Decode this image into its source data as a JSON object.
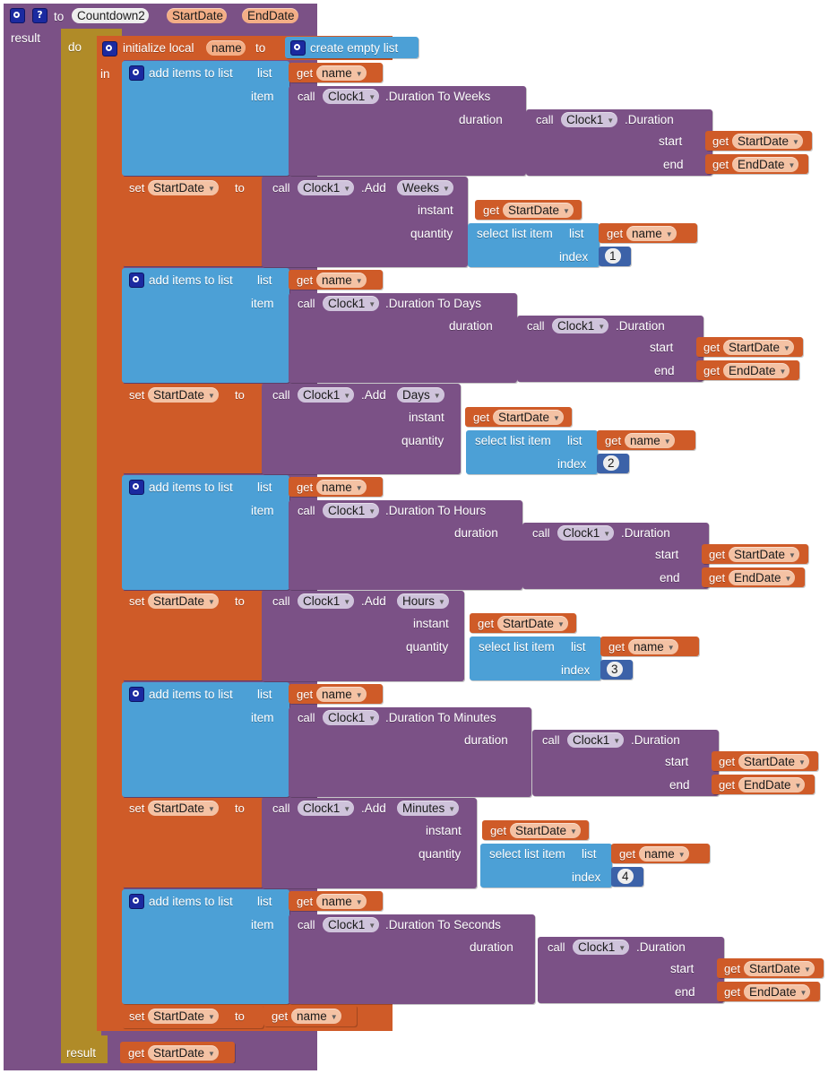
{
  "editor": {
    "name": "MIT App Inventor Blocks Editor",
    "colors": {
      "procedure": "#7B5186",
      "control_gold": "#B08B28",
      "variable_orange": "#CF5B28",
      "list_blue": "#4CA0D6",
      "math_blue": "#3C62A8",
      "field_lavender": "#CFC3DB",
      "field_salmon": "#F3AE86"
    }
  },
  "icons": {
    "gear": "gear-icon",
    "help": "help-icon",
    "dropdown_arrow": "▼"
  },
  "procedure": {
    "to_label": "to",
    "name": "Countdown2",
    "params": [
      "StartDate",
      "EndDate"
    ],
    "result_label": "result",
    "do_label": "do",
    "in_label": "in"
  },
  "local_init": {
    "label": "initialize local",
    "var_name": "name",
    "to_label": "to",
    "value_block": "create empty list"
  },
  "labels": {
    "add_items_to_list": "add items to list",
    "list": "list",
    "item": "item",
    "get": "get",
    "call": "call",
    "set": "set",
    "to": "to",
    "duration": "duration",
    "start": "start",
    "end": "end",
    "instant": "instant",
    "quantity": "quantity",
    "select_list_item": "select list item",
    "index": "index",
    "clock_component": "Clock1",
    "duration_method": ".Duration",
    "add_method": ".Add",
    "start_date": "StartDate",
    "end_date": "EndDate",
    "name_var": "name",
    "result": "result"
  },
  "sections": [
    {
      "unit": "Weeks",
      "duration_to_method": ".Duration To Weeks",
      "add_unit": "Weeks",
      "index": "1"
    },
    {
      "unit": "Days",
      "duration_to_method": ".Duration To Days",
      "add_unit": "Days",
      "index": "2"
    },
    {
      "unit": "Hours",
      "duration_to_method": ".Duration To Hours",
      "add_unit": "Hours",
      "index": "3"
    },
    {
      "unit": "Minutes",
      "duration_to_method": ".Duration To Minutes",
      "add_unit": "Minutes",
      "index": "4"
    },
    {
      "unit": "Seconds",
      "duration_to_method": ".Duration To Seconds",
      "add_unit": null,
      "index": null
    }
  ],
  "final": {
    "set_label": "set",
    "set_var": "StartDate",
    "to_label": "to",
    "get_label": "get",
    "get_var": "name"
  },
  "result_row": {
    "result_label": "result",
    "get_label": "get",
    "get_var": "StartDate"
  }
}
